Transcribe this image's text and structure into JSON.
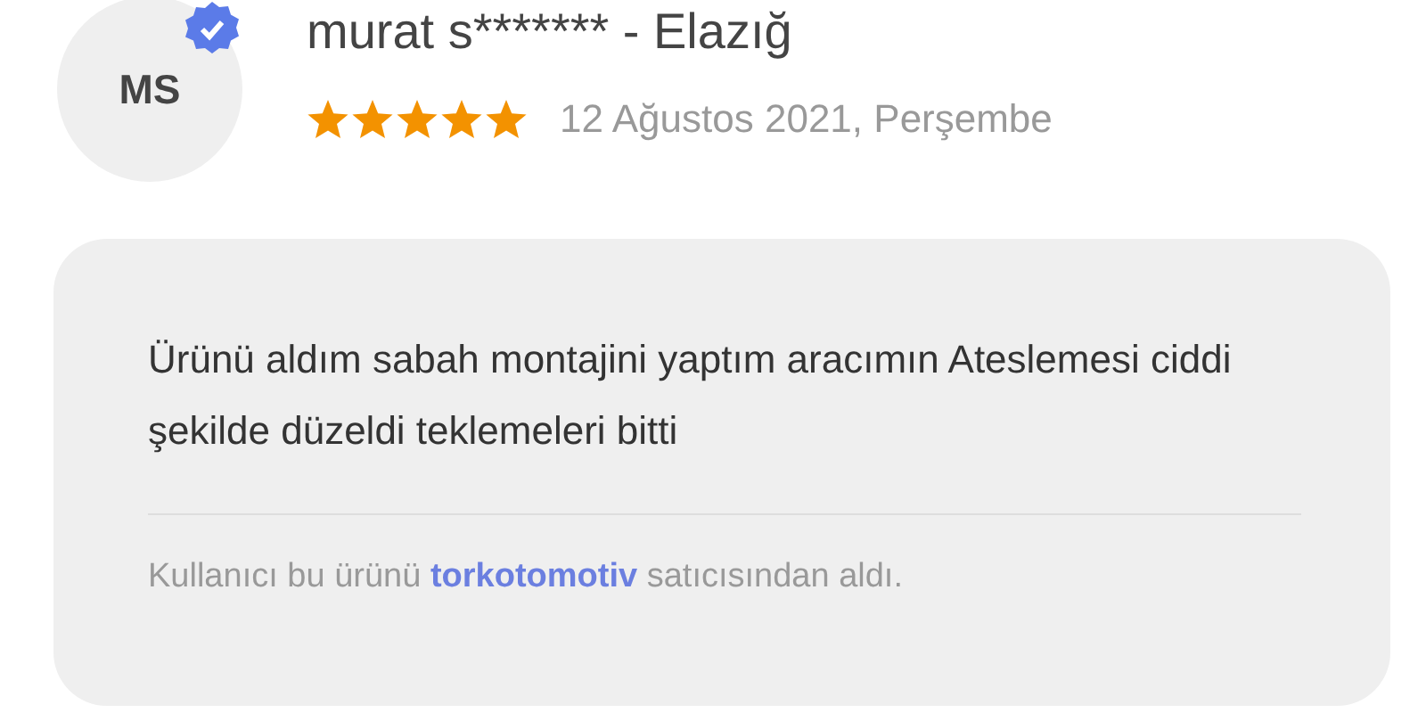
{
  "reviewer": {
    "initials": "MS",
    "verified": true,
    "name": "murat s******* - Elazığ",
    "stars": 5,
    "date": "12 Ağustos 2021, Perşembe"
  },
  "review": {
    "text": "Ürünü aldım sabah montajini yaptım aracımın Ateslemesi ciddi şekilde düzeldi teklemeleri bitti",
    "seller_note": {
      "before": "Kullanıcı bu ürünü",
      "seller": "torkotomotiv",
      "after": "satıcısından aldı."
    }
  }
}
